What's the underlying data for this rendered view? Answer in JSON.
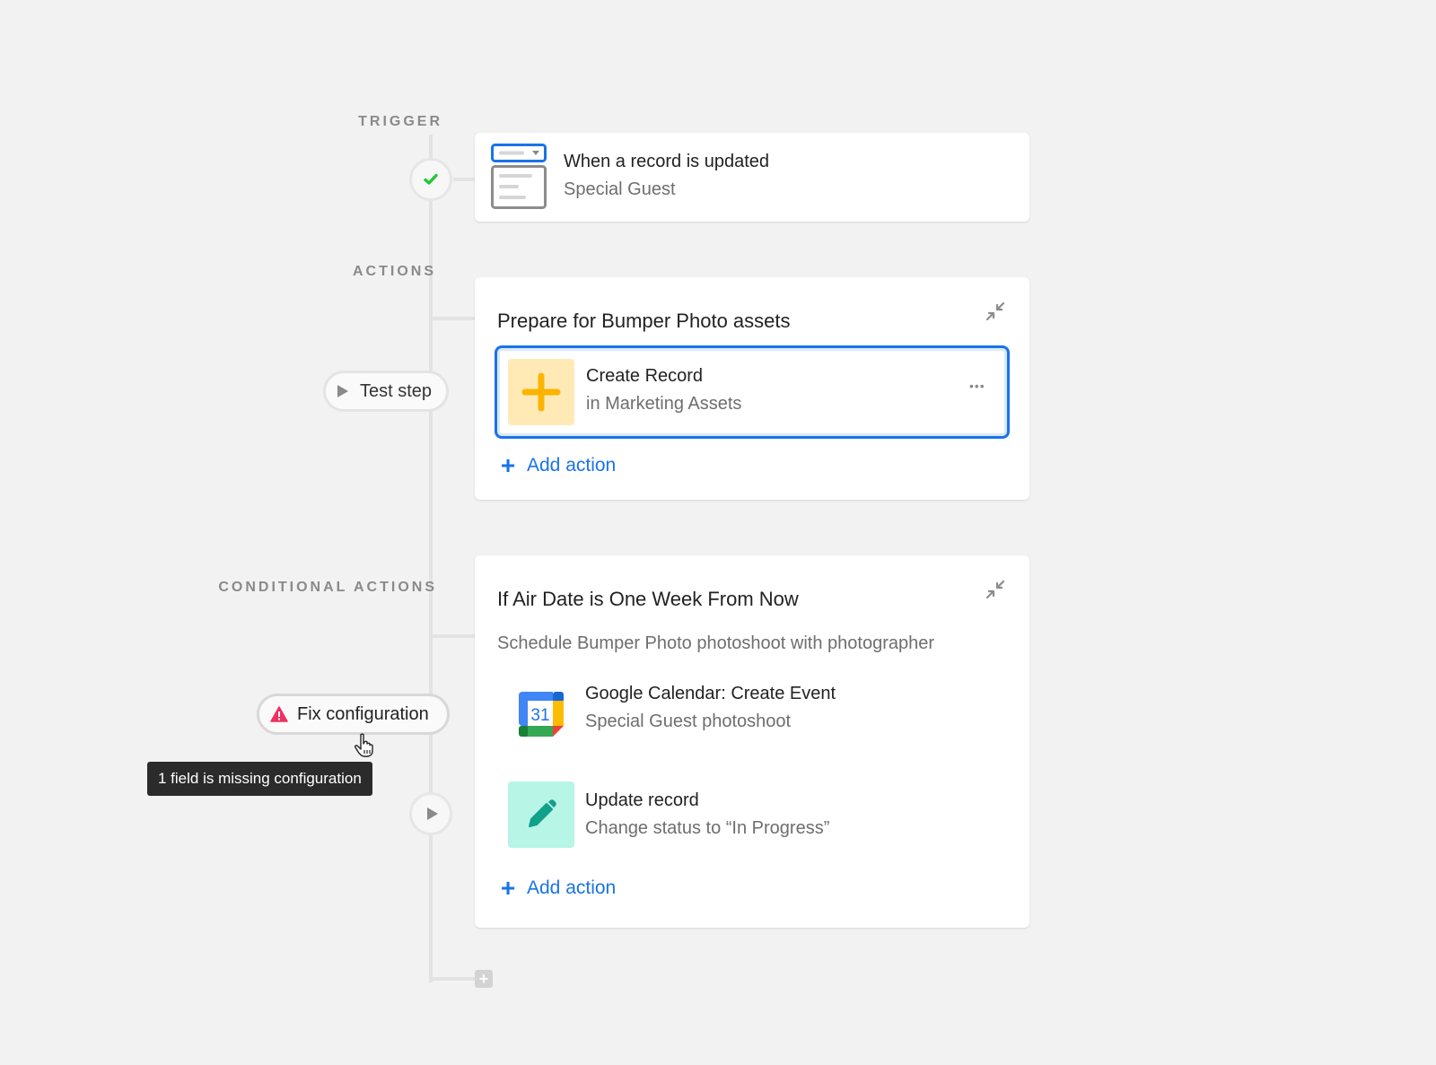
{
  "sections": {
    "trigger": "TRIGGER",
    "actions": "ACTIONS",
    "conditional": "CONDITIONAL ACTIONS"
  },
  "trigger": {
    "title": "When a record is updated",
    "subtitle": "Special Guest",
    "status_icon": "check-icon",
    "status_color": "#20c933"
  },
  "actions_group": {
    "title": "Prepare for Bumper Photo assets",
    "collapse_icon": "collapse-icon",
    "items": [
      {
        "title": "Create Record",
        "subtitle": "in Marketing Assets",
        "icon": "plus-icon",
        "icon_color": "#fcb400",
        "icon_bg": "#ffeab6",
        "selected": true,
        "more_label": "•••"
      }
    ],
    "add_action_label": "Add action",
    "test_step_label": "Test step"
  },
  "conditional_group": {
    "title": "If Air Date is One Week From Now",
    "description": "Schedule Bumper Photo photoshoot with photographer",
    "items": [
      {
        "title": "Google Calendar: Create Event",
        "subtitle": "Special Guest photoshoot",
        "icon": "google-calendar-icon",
        "icon_text": "31"
      },
      {
        "title": "Update record",
        "subtitle": "Change status to “In Progress”",
        "icon": "pencil-icon",
        "icon_color": "#11a08a",
        "icon_bg": "#c2f5e9"
      }
    ],
    "add_action_label": "Add action",
    "fix_label": "Fix configuration",
    "warning_color": "#ef3061",
    "tooltip": "1 field is missing configuration"
  },
  "colors": {
    "accent": "#1a73e8",
    "background": "#f2f2f2"
  }
}
